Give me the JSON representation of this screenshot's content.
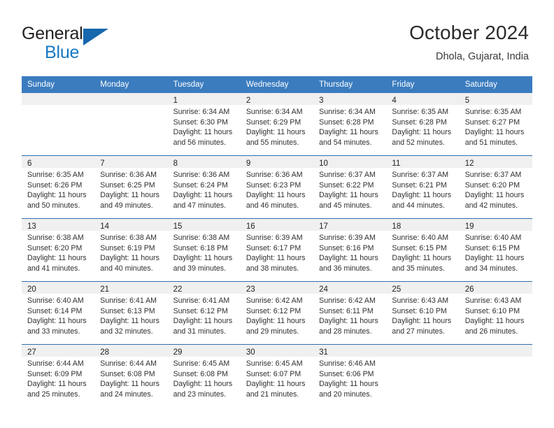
{
  "brand": {
    "line1": "General",
    "line2": "Blue",
    "flag_icon": "triangle-flag-icon",
    "accent_color": "#1678c2"
  },
  "header": {
    "title": "October 2024",
    "subtitle": "Dhola, Gujarat, India"
  },
  "theme": {
    "header_blue": "#3b7cbf",
    "rule_blue": "#2f6fb0",
    "daynum_band": "#f0f0f0"
  },
  "weekdays": [
    "Sunday",
    "Monday",
    "Tuesday",
    "Wednesday",
    "Thursday",
    "Friday",
    "Saturday"
  ],
  "weeks": [
    [
      {
        "day": "",
        "sunrise": "",
        "sunset": "",
        "daylight1": "",
        "daylight2": ""
      },
      {
        "day": "",
        "sunrise": "",
        "sunset": "",
        "daylight1": "",
        "daylight2": ""
      },
      {
        "day": "1",
        "sunrise": "Sunrise: 6:34 AM",
        "sunset": "Sunset: 6:30 PM",
        "daylight1": "Daylight: 11 hours",
        "daylight2": "and 56 minutes."
      },
      {
        "day": "2",
        "sunrise": "Sunrise: 6:34 AM",
        "sunset": "Sunset: 6:29 PM",
        "daylight1": "Daylight: 11 hours",
        "daylight2": "and 55 minutes."
      },
      {
        "day": "3",
        "sunrise": "Sunrise: 6:34 AM",
        "sunset": "Sunset: 6:28 PM",
        "daylight1": "Daylight: 11 hours",
        "daylight2": "and 54 minutes."
      },
      {
        "day": "4",
        "sunrise": "Sunrise: 6:35 AM",
        "sunset": "Sunset: 6:28 PM",
        "daylight1": "Daylight: 11 hours",
        "daylight2": "and 52 minutes."
      },
      {
        "day": "5",
        "sunrise": "Sunrise: 6:35 AM",
        "sunset": "Sunset: 6:27 PM",
        "daylight1": "Daylight: 11 hours",
        "daylight2": "and 51 minutes."
      }
    ],
    [
      {
        "day": "6",
        "sunrise": "Sunrise: 6:35 AM",
        "sunset": "Sunset: 6:26 PM",
        "daylight1": "Daylight: 11 hours",
        "daylight2": "and 50 minutes."
      },
      {
        "day": "7",
        "sunrise": "Sunrise: 6:36 AM",
        "sunset": "Sunset: 6:25 PM",
        "daylight1": "Daylight: 11 hours",
        "daylight2": "and 49 minutes."
      },
      {
        "day": "8",
        "sunrise": "Sunrise: 6:36 AM",
        "sunset": "Sunset: 6:24 PM",
        "daylight1": "Daylight: 11 hours",
        "daylight2": "and 47 minutes."
      },
      {
        "day": "9",
        "sunrise": "Sunrise: 6:36 AM",
        "sunset": "Sunset: 6:23 PM",
        "daylight1": "Daylight: 11 hours",
        "daylight2": "and 46 minutes."
      },
      {
        "day": "10",
        "sunrise": "Sunrise: 6:37 AM",
        "sunset": "Sunset: 6:22 PM",
        "daylight1": "Daylight: 11 hours",
        "daylight2": "and 45 minutes."
      },
      {
        "day": "11",
        "sunrise": "Sunrise: 6:37 AM",
        "sunset": "Sunset: 6:21 PM",
        "daylight1": "Daylight: 11 hours",
        "daylight2": "and 44 minutes."
      },
      {
        "day": "12",
        "sunrise": "Sunrise: 6:37 AM",
        "sunset": "Sunset: 6:20 PM",
        "daylight1": "Daylight: 11 hours",
        "daylight2": "and 42 minutes."
      }
    ],
    [
      {
        "day": "13",
        "sunrise": "Sunrise: 6:38 AM",
        "sunset": "Sunset: 6:20 PM",
        "daylight1": "Daylight: 11 hours",
        "daylight2": "and 41 minutes."
      },
      {
        "day": "14",
        "sunrise": "Sunrise: 6:38 AM",
        "sunset": "Sunset: 6:19 PM",
        "daylight1": "Daylight: 11 hours",
        "daylight2": "and 40 minutes."
      },
      {
        "day": "15",
        "sunrise": "Sunrise: 6:38 AM",
        "sunset": "Sunset: 6:18 PM",
        "daylight1": "Daylight: 11 hours",
        "daylight2": "and 39 minutes."
      },
      {
        "day": "16",
        "sunrise": "Sunrise: 6:39 AM",
        "sunset": "Sunset: 6:17 PM",
        "daylight1": "Daylight: 11 hours",
        "daylight2": "and 38 minutes."
      },
      {
        "day": "17",
        "sunrise": "Sunrise: 6:39 AM",
        "sunset": "Sunset: 6:16 PM",
        "daylight1": "Daylight: 11 hours",
        "daylight2": "and 36 minutes."
      },
      {
        "day": "18",
        "sunrise": "Sunrise: 6:40 AM",
        "sunset": "Sunset: 6:15 PM",
        "daylight1": "Daylight: 11 hours",
        "daylight2": "and 35 minutes."
      },
      {
        "day": "19",
        "sunrise": "Sunrise: 6:40 AM",
        "sunset": "Sunset: 6:15 PM",
        "daylight1": "Daylight: 11 hours",
        "daylight2": "and 34 minutes."
      }
    ],
    [
      {
        "day": "20",
        "sunrise": "Sunrise: 6:40 AM",
        "sunset": "Sunset: 6:14 PM",
        "daylight1": "Daylight: 11 hours",
        "daylight2": "and 33 minutes."
      },
      {
        "day": "21",
        "sunrise": "Sunrise: 6:41 AM",
        "sunset": "Sunset: 6:13 PM",
        "daylight1": "Daylight: 11 hours",
        "daylight2": "and 32 minutes."
      },
      {
        "day": "22",
        "sunrise": "Sunrise: 6:41 AM",
        "sunset": "Sunset: 6:12 PM",
        "daylight1": "Daylight: 11 hours",
        "daylight2": "and 31 minutes."
      },
      {
        "day": "23",
        "sunrise": "Sunrise: 6:42 AM",
        "sunset": "Sunset: 6:12 PM",
        "daylight1": "Daylight: 11 hours",
        "daylight2": "and 29 minutes."
      },
      {
        "day": "24",
        "sunrise": "Sunrise: 6:42 AM",
        "sunset": "Sunset: 6:11 PM",
        "daylight1": "Daylight: 11 hours",
        "daylight2": "and 28 minutes."
      },
      {
        "day": "25",
        "sunrise": "Sunrise: 6:43 AM",
        "sunset": "Sunset: 6:10 PM",
        "daylight1": "Daylight: 11 hours",
        "daylight2": "and 27 minutes."
      },
      {
        "day": "26",
        "sunrise": "Sunrise: 6:43 AM",
        "sunset": "Sunset: 6:10 PM",
        "daylight1": "Daylight: 11 hours",
        "daylight2": "and 26 minutes."
      }
    ],
    [
      {
        "day": "27",
        "sunrise": "Sunrise: 6:44 AM",
        "sunset": "Sunset: 6:09 PM",
        "daylight1": "Daylight: 11 hours",
        "daylight2": "and 25 minutes."
      },
      {
        "day": "28",
        "sunrise": "Sunrise: 6:44 AM",
        "sunset": "Sunset: 6:08 PM",
        "daylight1": "Daylight: 11 hours",
        "daylight2": "and 24 minutes."
      },
      {
        "day": "29",
        "sunrise": "Sunrise: 6:45 AM",
        "sunset": "Sunset: 6:08 PM",
        "daylight1": "Daylight: 11 hours",
        "daylight2": "and 23 minutes."
      },
      {
        "day": "30",
        "sunrise": "Sunrise: 6:45 AM",
        "sunset": "Sunset: 6:07 PM",
        "daylight1": "Daylight: 11 hours",
        "daylight2": "and 21 minutes."
      },
      {
        "day": "31",
        "sunrise": "Sunrise: 6:46 AM",
        "sunset": "Sunset: 6:06 PM",
        "daylight1": "Daylight: 11 hours",
        "daylight2": "and 20 minutes."
      },
      {
        "day": "",
        "sunrise": "",
        "sunset": "",
        "daylight1": "",
        "daylight2": ""
      },
      {
        "day": "",
        "sunrise": "",
        "sunset": "",
        "daylight1": "",
        "daylight2": ""
      }
    ]
  ]
}
